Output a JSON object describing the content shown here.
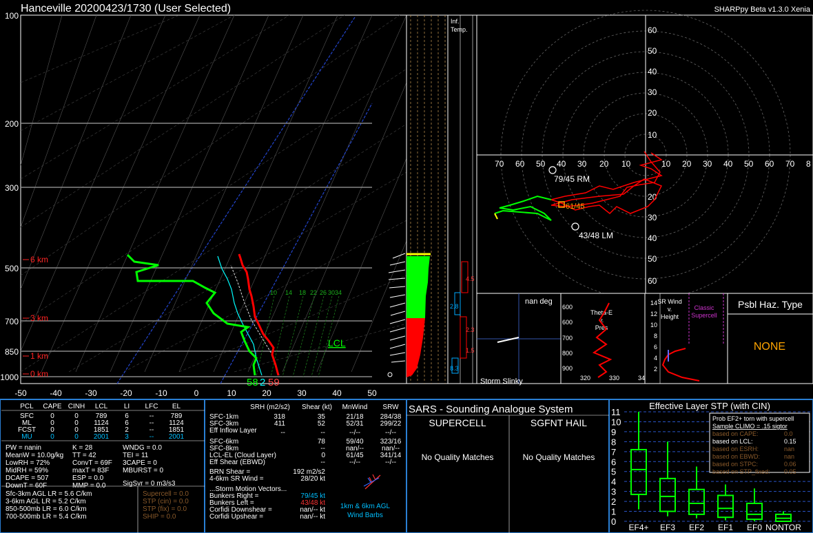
{
  "header": {
    "title": "Hanceville   20200423/1730  (User Selected)",
    "version": "SHARPpy Beta v1.3.0 Xenia"
  },
  "skewt": {
    "pressure_labels": [
      "100",
      "200",
      "300",
      "500",
      "700",
      "850",
      "1000"
    ],
    "temp_labels": [
      "-50",
      "-40",
      "-30",
      "-20",
      "-10",
      "0",
      "10",
      "20",
      "30",
      "40",
      "50"
    ],
    "height_labels": [
      "6 km",
      "3 km",
      "1 km",
      "0 km"
    ],
    "lcl_label": "LCL",
    "surface_values": {
      "dewpoint": "58",
      "wetbulb": "2",
      "temp": "59"
    },
    "mixing_ratio_labels": [
      "10",
      "14",
      "18",
      "22",
      "26",
      "30",
      "34"
    ]
  },
  "inflow": {
    "label_line1": "Inf.",
    "label_line2": "Temp.",
    "values": [
      "4.5",
      "2.8",
      "2.3",
      "1.5",
      "8.3"
    ]
  },
  "hodograph": {
    "rings": [
      "10",
      "20",
      "30",
      "40",
      "50",
      "60"
    ],
    "x_labels": [
      "70",
      "60",
      "50",
      "40",
      "30",
      "20",
      "10",
      "10",
      "20",
      "30",
      "40",
      "50",
      "60",
      "70",
      "8"
    ],
    "y_labels_up": [
      "60",
      "50",
      "40",
      "30",
      "20",
      "10"
    ],
    "y_labels_down": [
      "20",
      "30",
      "40",
      "50",
      "60"
    ],
    "rm_label": "79/45 RM",
    "lm_label": "43/48 LM",
    "mean_label": "61/45"
  },
  "slinky": {
    "title": "nan deg",
    "label": "Storm Slinky"
  },
  "theta": {
    "title_line1": "Theta-E",
    "title_line2": "v.",
    "title_line3": "Pres",
    "y_labels": [
      "600",
      "700",
      "800",
      "900",
      "600"
    ],
    "x_labels": [
      "320",
      "330",
      "34"
    ]
  },
  "srwind": {
    "title_line1": "SR Wind",
    "title_line2": "v.",
    "title_line3": "Height",
    "classic_line1": "Classic",
    "classic_line2": "Supercell",
    "y_labels": [
      "14",
      "12",
      "10",
      "8",
      "6",
      "4",
      "2"
    ]
  },
  "hazard": {
    "title": "Psbl Haz. Type",
    "value": "NONE"
  },
  "parcels": {
    "headers": [
      "PCL",
      "CAPE",
      "CINH",
      "LCL",
      "LI",
      "LFC",
      "EL"
    ],
    "rows": [
      [
        "SFC",
        "0",
        "0",
        "789",
        "6",
        "--",
        "789"
      ],
      [
        "ML",
        "0",
        "0",
        "1124",
        "6",
        "--",
        "1124"
      ],
      [
        "FCST",
        "0",
        "0",
        "1851",
        "2",
        "--",
        "1851"
      ],
      [
        "MU",
        "0",
        "0",
        "2001",
        "3",
        "--",
        "2001"
      ]
    ]
  },
  "indices": {
    "col1": [
      "PW = nanin",
      "MeanW = 10.0g/kg",
      "LowRH = 72%",
      "MidRH = 59%",
      "DCAPE = 507",
      "DownT = 60F"
    ],
    "col2": [
      "K = 28",
      "TT = 42",
      "ConvT = 69F",
      "maxT = 83F",
      "ESP = 0.0",
      "MMP = 0.0"
    ],
    "col3": [
      "WNDG = 0.0",
      "TEI = 11",
      "3CAPE = 0",
      "MBURST = 0",
      "",
      ""
    ],
    "sigsvr": "SigSvr = 0 m3/s3"
  },
  "lapse": [
    "Sfc-3km AGL LR = 5.6 C/km",
    "3-6km AGL LR = 5.2 C/km",
    "850-500mb LR = 6.0 C/km",
    "700-500mb LR = 5.4 C/km"
  ],
  "composites": [
    "Supercell = 0.0",
    "STP (cin) = 0.0",
    "STP (fix) = 0.0",
    "SHIP = 0.0"
  ],
  "kinematics": {
    "headers": [
      "SRH (m2/s2)",
      "Shear (kt)",
      "MnWind",
      "SRW"
    ],
    "rows": [
      [
        "SFC-1km",
        "318",
        "35",
        "21/18",
        "284/38"
      ],
      [
        "SFC-3km",
        "411",
        "52",
        "52/31",
        "299/22"
      ],
      [
        "Eff Inflow Layer",
        "--",
        "--",
        "--/--",
        "--/--"
      ],
      [
        "",
        "",
        "",
        "",
        ""
      ],
      [
        "SFC-6km",
        "",
        "78",
        "59/40",
        "323/16"
      ],
      [
        "SFC-8km",
        "",
        "--",
        "nan/--",
        "nan/--"
      ],
      [
        "LCL-EL (Cloud Layer)",
        "",
        "0",
        "61/45",
        "341/14"
      ],
      [
        "Eff Shear (EBWD)",
        "",
        "--",
        "--/--",
        "--/--"
      ]
    ],
    "brn_shear_label": "BRN Shear =",
    "brn_shear_value": "192 m2/s2",
    "sr_wind_label": "4-6km SR Wind =",
    "sr_wind_value": "28/20 kt",
    "motion_title": "...Storm Motion Vectors...",
    "motion": [
      {
        "label": "Bunkers Right =",
        "value": "79/45 kt"
      },
      {
        "label": "Bunkers Left =",
        "value": "43/48 kt"
      },
      {
        "label": "Corfidi Downshear =",
        "value": "nan/-- kt"
      },
      {
        "label": "Corfidi Upshear =",
        "value": "nan/-- kt"
      }
    ],
    "barb_label_line1": "1km & 6km AGL",
    "barb_label_line2": "Wind Barbs"
  },
  "sars": {
    "title": "SARS - Sounding Analogue System",
    "supercell_title": "SUPERCELL",
    "hail_title": "SGFNT HAIL",
    "supercell_result": "No Quality Matches",
    "hail_result": "No Quality Matches"
  },
  "stp_chart": {
    "title": "Effective Layer STP (with CIN)",
    "y_labels": [
      "11",
      "10",
      "9",
      "8",
      "7",
      "6",
      "5",
      "4",
      "3",
      "2",
      "1",
      "0"
    ],
    "categories": [
      "EF4+",
      "EF3",
      "EF2",
      "EF1",
      "EF0",
      "NONTOR"
    ],
    "prob_title": "Prob EF2+ torn with supercell",
    "prob_sub": "Sample CLIMO = .15 sigtor",
    "prob_rows": [
      {
        "label": "based on CAPE:",
        "value": "0.0"
      },
      {
        "label": "based on LCL:",
        "value": "0.15"
      },
      {
        "label": "based on ESRH:",
        "value": "nan"
      },
      {
        "label": "based on EBWD:",
        "value": "nan"
      },
      {
        "label": "based on STPC:",
        "value": "0.06"
      },
      {
        "label": "based on STP_fixed:",
        "value": "0.05"
      }
    ]
  },
  "chart_data": {
    "type": "box",
    "title": "Effective Layer STP (with CIN)",
    "ylim": [
      0,
      11
    ],
    "categories": [
      "EF4+",
      "EF3",
      "EF2",
      "EF1",
      "EF0",
      "NONTOR"
    ],
    "boxes": [
      {
        "category": "EF4+",
        "whisker_low": 1.2,
        "q1": 2.7,
        "median": 5.2,
        "q3": 7.2,
        "whisker_high": 11.0
      },
      {
        "category": "EF3",
        "whisker_low": 0.5,
        "q1": 1.0,
        "median": 2.5,
        "q3": 4.3,
        "whisker_high": 8.0
      },
      {
        "category": "EF2",
        "whisker_low": 0.3,
        "q1": 0.7,
        "median": 1.8,
        "q3": 3.2,
        "whisker_high": 5.5
      },
      {
        "category": "EF1",
        "whisker_low": 0.1,
        "q1": 0.4,
        "median": 1.3,
        "q3": 2.6,
        "whisker_high": 3.7
      },
      {
        "category": "EF0",
        "whisker_low": 0.0,
        "q1": 0.2,
        "median": 0.7,
        "q3": 1.8,
        "whisker_high": 3.3
      },
      {
        "category": "NONTOR",
        "whisker_low": 0.0,
        "q1": 0.0,
        "median": 0.3,
        "q3": 0.7,
        "whisker_high": 1.0
      }
    ]
  },
  "colors": {
    "temp": "#ff0000",
    "dewpoint": "#00ff00",
    "wetbulb": "#00ffff",
    "accent": "#00bfff",
    "hazard": "#ffa500",
    "stp": "#00ff00"
  }
}
